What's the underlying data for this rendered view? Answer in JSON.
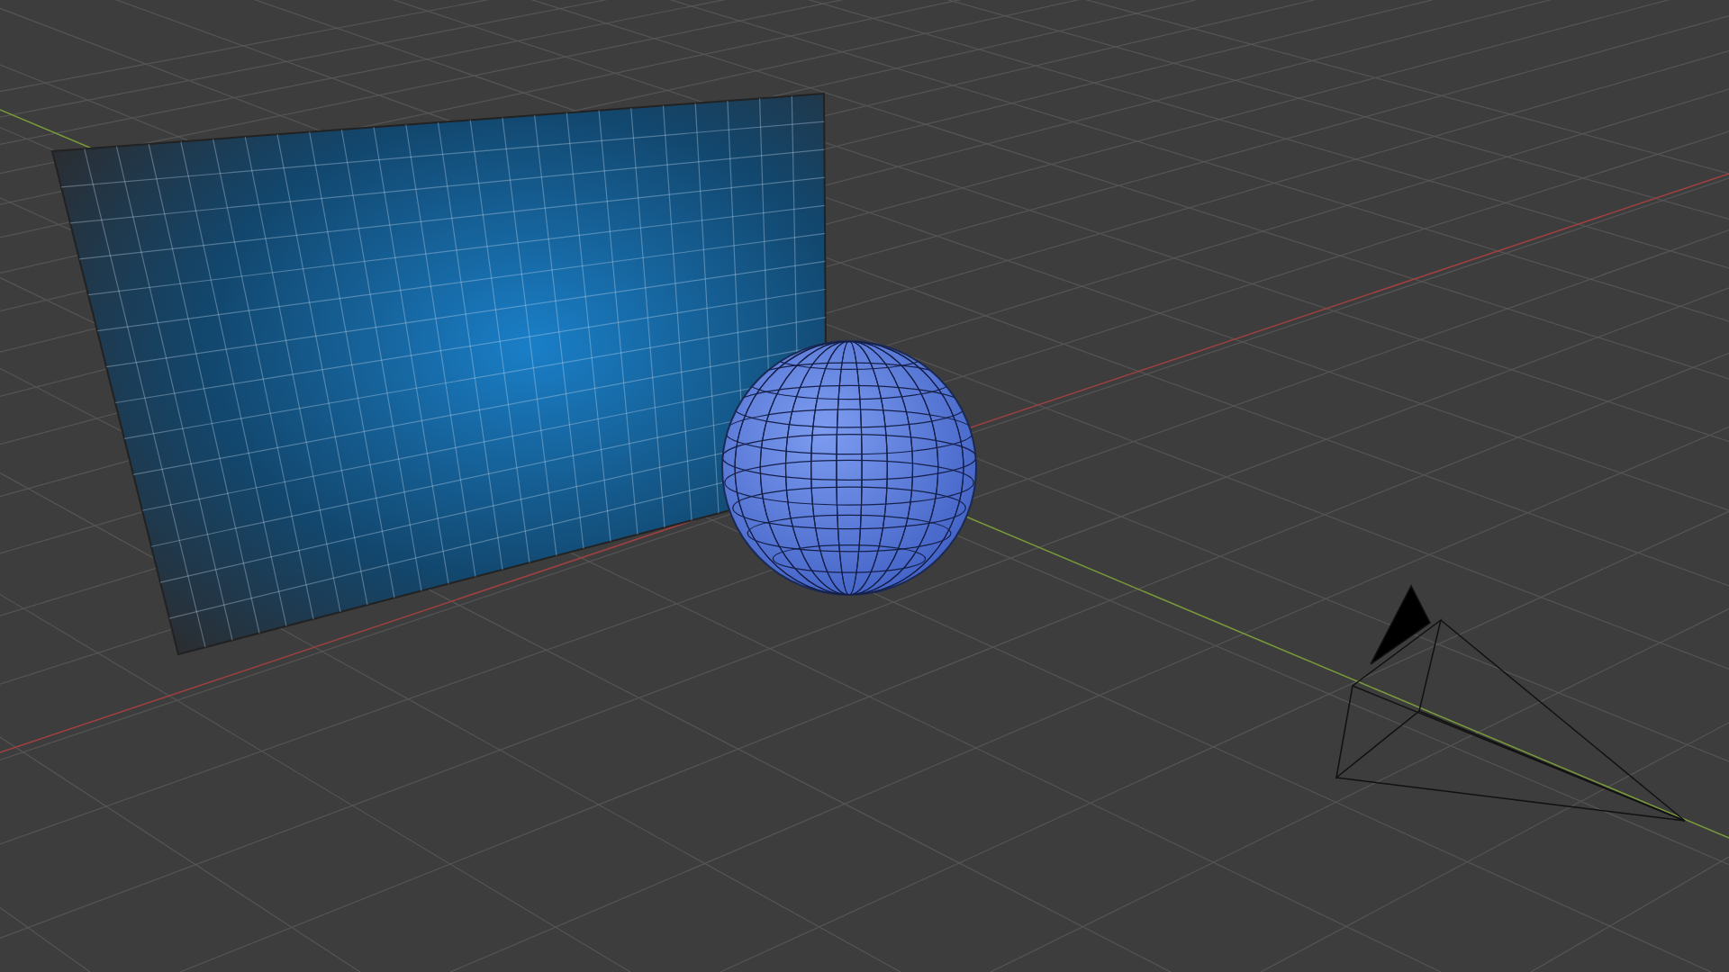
{
  "viewport": {
    "objects": [
      {
        "kind": "plane"
      },
      {
        "kind": "sphere"
      },
      {
        "kind": "camera"
      }
    ]
  }
}
